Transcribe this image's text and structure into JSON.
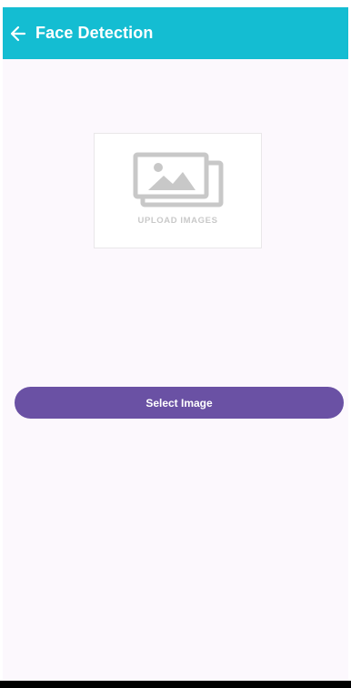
{
  "app_bar": {
    "title": "Face Detection",
    "back_icon": "arrow-left-icon",
    "color": "#14bdd2"
  },
  "upload": {
    "label": "UPLOAD IMAGES",
    "icon": "image-stack-icon"
  },
  "actions": {
    "select_image_label": "Select Image",
    "button_color": "#6a51a4"
  }
}
